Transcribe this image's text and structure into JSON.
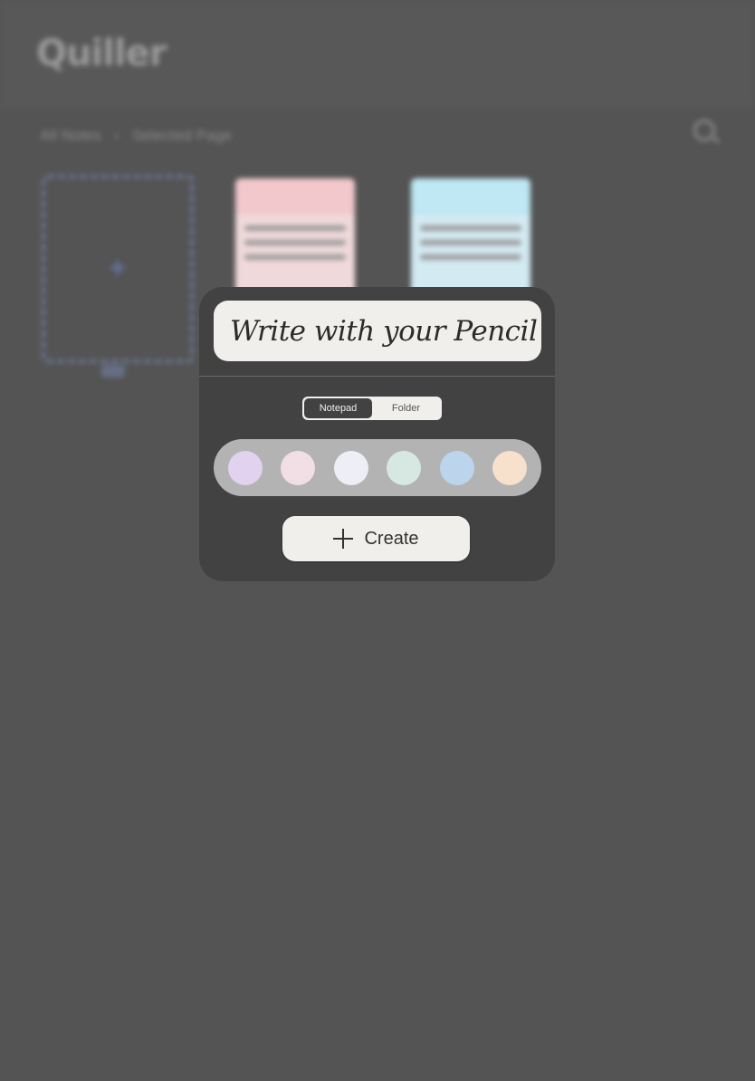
{
  "background": {
    "app_logo": "Quiller",
    "breadcrumb": [
      "All Notes",
      "Selected Page"
    ]
  },
  "dialog": {
    "title_placeholder": "Write with your Pencil",
    "segmented_control": {
      "options": [
        "Notepad",
        "Folder"
      ],
      "selected": "Notepad"
    },
    "colors": [
      "#e1d2f0",
      "#f2dfe6",
      "#eeeef6",
      "#d7e8e3",
      "#bcd4ec",
      "#f7e0cc"
    ],
    "create_button_label": "Create",
    "create_icon": "plus-icon"
  }
}
